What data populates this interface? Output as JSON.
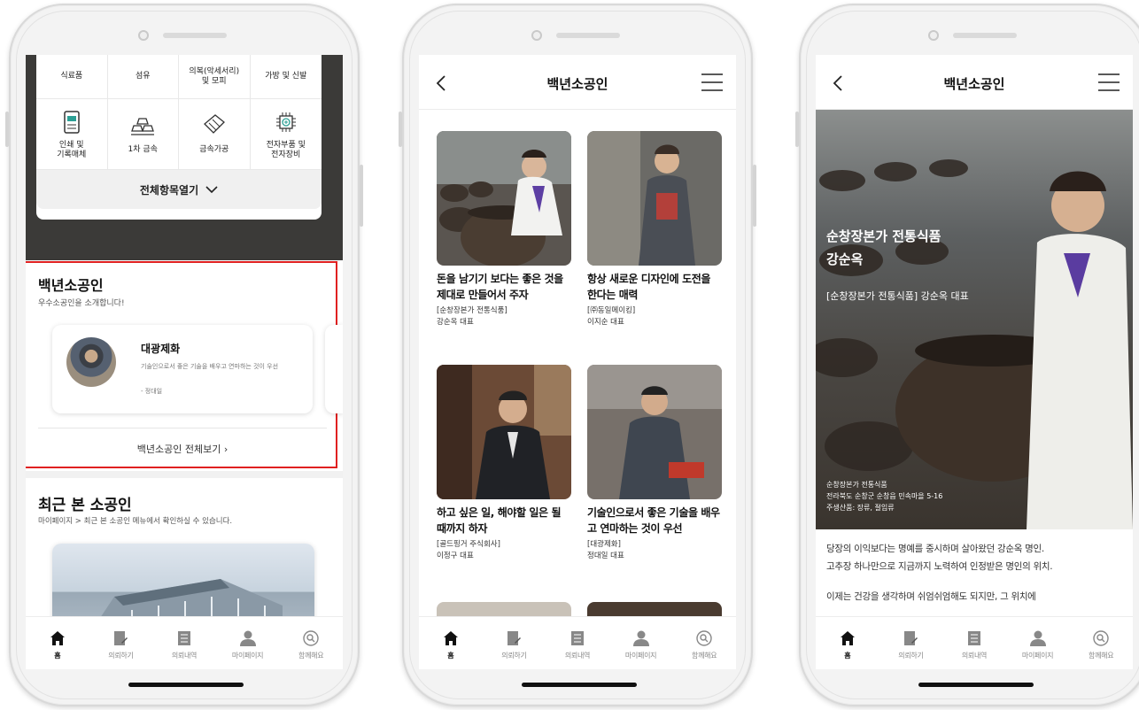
{
  "nav_items": [
    {
      "label": "홈",
      "icon": "home-icon",
      "active": true
    },
    {
      "label": "의뢰하기",
      "icon": "edit-doc-icon",
      "active": false
    },
    {
      "label": "의뢰내역",
      "icon": "list-doc-icon",
      "active": false
    },
    {
      "label": "마이페이지",
      "icon": "person-icon",
      "active": false
    },
    {
      "label": "함께해요",
      "icon": "search-badge-icon",
      "active": false
    }
  ],
  "screen1": {
    "categories_top": [
      "식료품",
      "섬유",
      "의복(악세서리)\n및 모피",
      "가방 및 신발"
    ],
    "categories_icons": [
      {
        "label": "인쇄 및\n기록매체",
        "icon": "print-media-icon"
      },
      {
        "label": "1차 금속",
        "icon": "metal-bars-icon"
      },
      {
        "label": "금속가공",
        "icon": "metal-process-icon"
      },
      {
        "label": "전자부품 및\n전자장비",
        "icon": "chip-icon"
      }
    ],
    "open_all": "전체항목열기",
    "century_title": "백년소공인",
    "century_sub": "우수소공인을 소개합니다!",
    "feature": {
      "name": "대광제화",
      "desc": "기술인으로서 좋은 기술을 배우고 연마하는 것이 우선",
      "person": "- 정대일"
    },
    "view_all": "백년소공인 전체보기",
    "recent_title": "최근 본 소공인",
    "recent_sub": "마이페이지 > 최근 본 소공인 메뉴에서 확인하실 수 있습니다."
  },
  "screen2": {
    "header_title": "백년소공인",
    "items": [
      {
        "title": "돈을 남기기 보다는 좋은 것을 제대로 만들어서 주자",
        "shop": "[순창장본가 전통식품]",
        "owner": "강순옥 대표"
      },
      {
        "title": "항상 새로운 디자인에 도전을 한다는 매력",
        "shop": "[㈜동일메이킹]",
        "owner": "이지순 대표"
      },
      {
        "title": "하고 싶은 일, 해야할 일은 될 때까지 하자",
        "shop": "[골드핑거 주식회사]",
        "owner": "이정구 대표"
      },
      {
        "title": "기술인으로서 좋은 기술을 배우고 연마하는 것이 우선",
        "shop": "[대광제화]",
        "owner": "정대일 대표"
      }
    ]
  },
  "screen3": {
    "header_title": "백년소공인",
    "hero_title_1": "순창장본가 전통식품",
    "hero_title_2": "강순옥",
    "hero_sub": "[순창장본가 전통식품] 강순옥 대표",
    "info_1": "순창장본가 전통식품",
    "info_2": "전라북도 순창군 순창읍 민속마을 5-16",
    "info_3": "주생산품: 장류, 절임류",
    "para_1": "당장의 이익보다는 명예를 중시하며 살아왔던 강순옥 명인.",
    "para_2": "고추장 하나만으로 지금까지 노력하여 인정받은 명인의 위치.",
    "para_3": "이제는 건강을 생각하며 쉬엄쉬엄해도 되지만, 그 위치에"
  }
}
